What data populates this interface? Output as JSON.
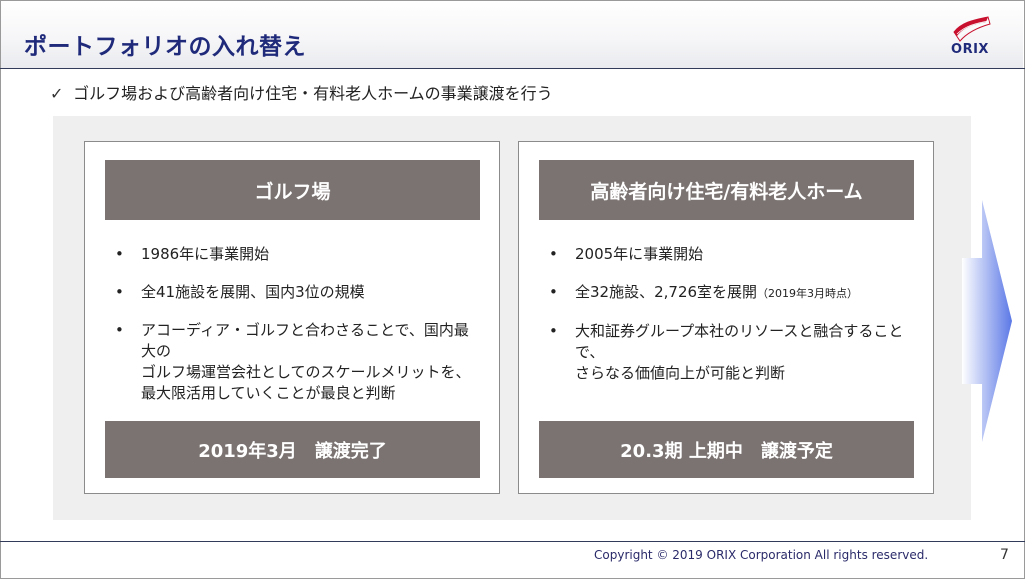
{
  "slide": {
    "title": "ポートフォリオの入れ替え",
    "logo_text": "ORIX",
    "lead_check": "✓",
    "lead": "ゴルフ場および高齢者向け住宅・有料老人ホームの事業譲渡を行う"
  },
  "cards": [
    {
      "heading": "ゴルフ場",
      "bullets": [
        {
          "lines": [
            "1986年に事業開始"
          ]
        },
        {
          "lines": [
            "全41施設を展開、国内3位の規模"
          ]
        },
        {
          "lines": [
            "アコーディア・ゴルフと合わさることで、国内最大の",
            "ゴルフ場運営会社としてのスケールメリットを、",
            "最大限活用していくことが最良と判断"
          ]
        }
      ],
      "footer": "2019年3月　譲渡完了"
    },
    {
      "heading": "高齢者向け住宅/有料老人ホーム",
      "bullets": [
        {
          "lines": [
            "2005年に事業開始"
          ]
        },
        {
          "lines": [
            "全32施設、2,726室を展開"
          ],
          "note": "（2019年3月時点）"
        },
        {
          "lines": [
            "大和証券グループ本社のリソースと融合することで、",
            "さらなる価値向上が可能と判断"
          ]
        }
      ],
      "footer": "20.3期 上期中　譲渡予定"
    }
  ],
  "footer": {
    "copyright": "Copyright © 2019 ORIX Corporation  All rights reserved.",
    "page_number": "7"
  },
  "colors": {
    "title": "#1f2a7a",
    "card_band": "#7a7371",
    "panel": "#efefef",
    "arrow": "#5b78e6",
    "logo": "#c8102e"
  },
  "icons": {
    "check": "check-icon",
    "logo": "orix-logo",
    "arrow": "right-arrow-icon"
  }
}
